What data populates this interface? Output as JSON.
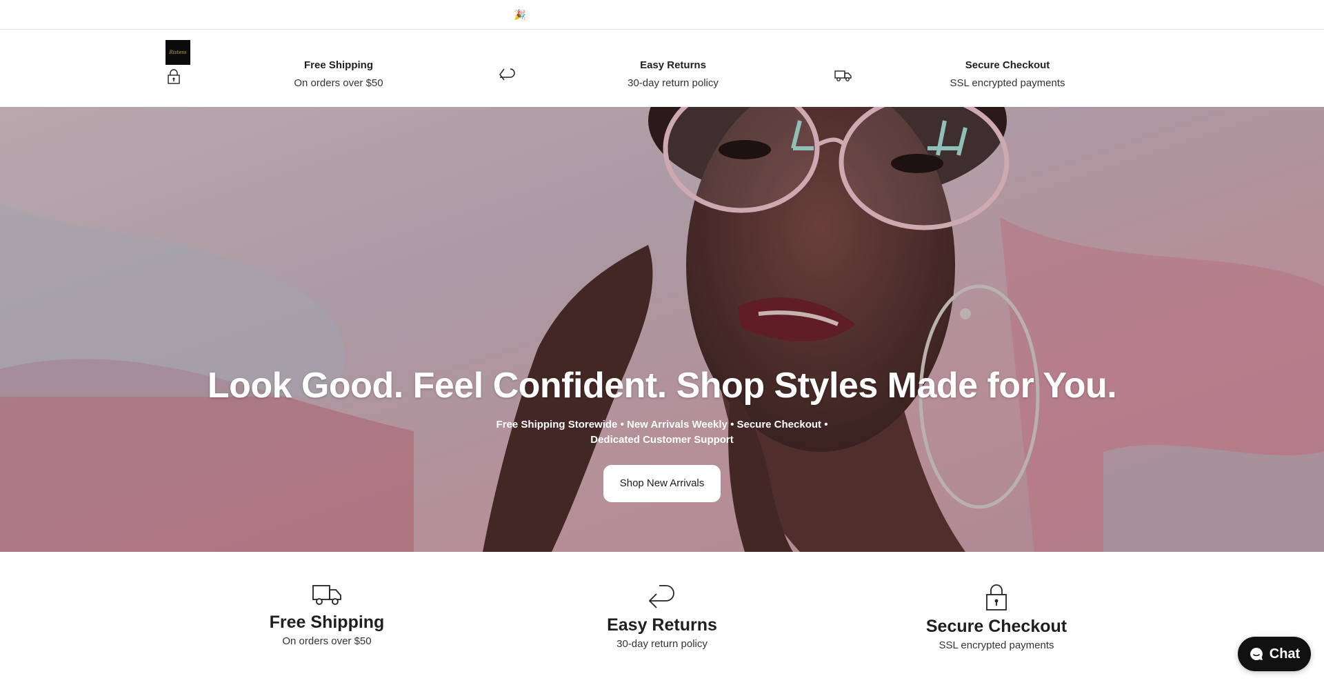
{
  "announcement": {
    "emoji": "🎉"
  },
  "header": {
    "logo_text": "Ristess",
    "features": [
      {
        "title": "Free Shipping",
        "subtitle": "On orders over $50"
      },
      {
        "title": "Easy Returns",
        "subtitle": "30-day return policy"
      },
      {
        "title": "Secure Checkout",
        "subtitle": "SSL encrypted payments"
      }
    ]
  },
  "hero": {
    "title": "Look Good. Feel Confident. Shop Styles Made for You.",
    "subtitle": "Free Shipping Storewide • New Arrivals Weekly • Secure Checkout • Dedicated Customer Support",
    "button_label": "Shop New Arrivals"
  },
  "features": [
    {
      "icon": "truck-icon",
      "title": "Free Shipping",
      "subtitle": "On orders over $50"
    },
    {
      "icon": "return-arrow-icon",
      "title": "Easy Returns",
      "subtitle": "30-day return policy"
    },
    {
      "icon": "lock-icon",
      "title": "Secure Checkout",
      "subtitle": "SSL encrypted payments"
    }
  ],
  "chat": {
    "label": "Chat"
  },
  "colors": {
    "accent": "#111111",
    "hero_bg": "#c9b5bd",
    "text": "#1f1f1f"
  }
}
